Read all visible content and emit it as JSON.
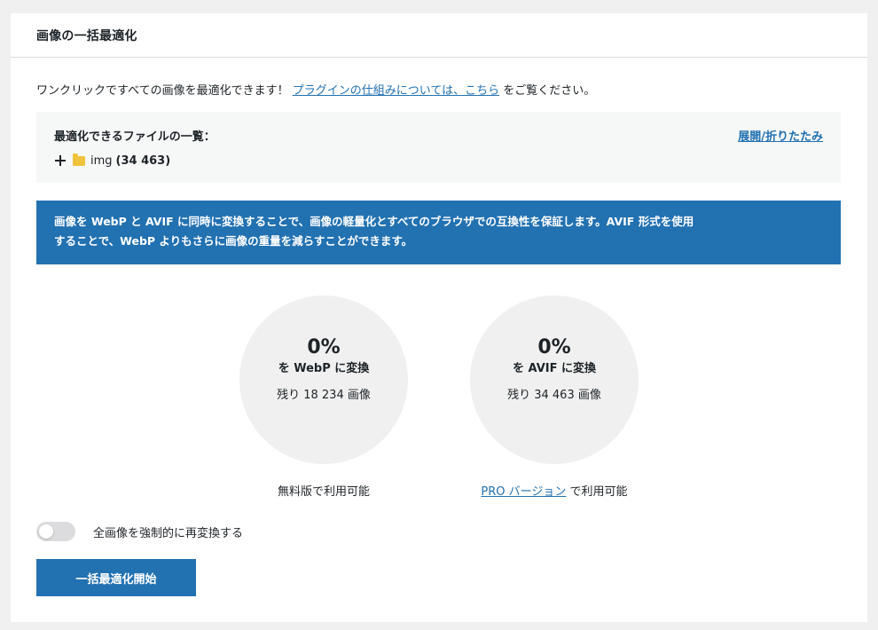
{
  "header": {
    "title": "画像の一括最適化"
  },
  "intro": {
    "text": "ワンクリックですべての画像を最適化できます！",
    "link_label": "プラグインの仕組みについては、こちら",
    "suffix": "をご覧ください。"
  },
  "file_list": {
    "title": "最適化できるファイルの一覧：",
    "toggle_label": "展開/折りたたみ",
    "items": [
      {
        "name": "img",
        "count": "(34 463)"
      }
    ]
  },
  "notice": {
    "line1": "画像を WebP と AVIF に同時に変換することで、画像の軽量化とすべてのブラウザでの互換性を保証します。AVIF 形式を使用",
    "line2": "することで、WebP よりもさらに画像の重量を減らすことができます。"
  },
  "stats": {
    "webp": {
      "percent": "0%",
      "label": "を WebP に変換",
      "remaining": "残り 18 234 画像",
      "availability": "無料版で利用可能"
    },
    "avif": {
      "percent": "0%",
      "label": "を AVIF に変換",
      "remaining": "残り 34 463 画像",
      "pro_link": "PRO バージョン",
      "availability_suffix": "で利用可能"
    }
  },
  "force_toggle": {
    "label": "全画像を強制的に再変換する",
    "enabled": false
  },
  "action": {
    "start_label": "一括最適化開始"
  },
  "colors": {
    "primary": "#2271b1",
    "circle_bg": "#f0f0f0",
    "folder": "#f0c33c",
    "page_bg": "#f0f0f1"
  }
}
